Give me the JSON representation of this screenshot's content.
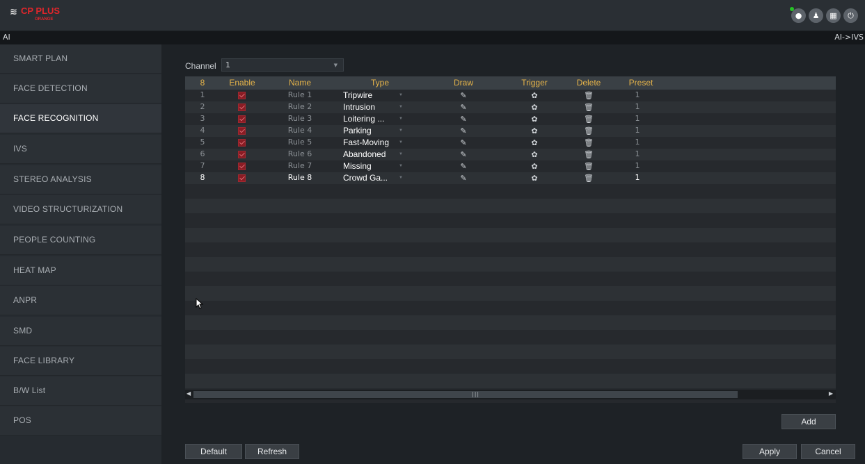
{
  "app": {
    "logo_mark": "≋",
    "logo_text": "CP PLUS",
    "logo_sub": "ORANGE"
  },
  "header_icons": [
    {
      "name": "camera-eye-icon",
      "glyph": "●"
    },
    {
      "name": "user-icon",
      "glyph": "♟"
    },
    {
      "name": "menu-grid-icon",
      "glyph": "▦"
    },
    {
      "name": "power-icon",
      "glyph": "⏻"
    }
  ],
  "breadcrumb": {
    "left": "AI",
    "right": "AI->IVS"
  },
  "sidebar": {
    "items": [
      {
        "label": "SMART PLAN"
      },
      {
        "label": "FACE DETECTION"
      },
      {
        "label": "FACE RECOGNITION"
      },
      {
        "label": "IVS"
      },
      {
        "label": "STEREO ANALYSIS"
      },
      {
        "label": "VIDEO STRUCTURIZATION"
      },
      {
        "label": "PEOPLE COUNTING"
      },
      {
        "label": "HEAT MAP"
      },
      {
        "label": "ANPR"
      },
      {
        "label": "SMD"
      },
      {
        "label": "FACE LIBRARY"
      },
      {
        "label": "B/W List"
      },
      {
        "label": "POS"
      }
    ],
    "active": "FACE RECOGNITION"
  },
  "channel": {
    "label": "Channel",
    "value": "1"
  },
  "table": {
    "headers": {
      "index": "8",
      "enable": "Enable",
      "name": "Name",
      "type": "Type",
      "draw": "Draw",
      "trigger": "Trigger",
      "delete": "Delete",
      "preset": "Preset"
    },
    "rows": [
      {
        "index": "1",
        "enabled": true,
        "name": "Rule 1",
        "type": "Tripwire",
        "preset": "1"
      },
      {
        "index": "2",
        "enabled": true,
        "name": "Rule 2",
        "type": "Intrusion",
        "preset": "1"
      },
      {
        "index": "3",
        "enabled": true,
        "name": "Rule 3",
        "type": "Loitering ...",
        "preset": "1"
      },
      {
        "index": "4",
        "enabled": true,
        "name": "Rule 4",
        "type": "Parking",
        "preset": "1"
      },
      {
        "index": "5",
        "enabled": true,
        "name": "Rule 5",
        "type": "Fast-Moving",
        "preset": "1"
      },
      {
        "index": "6",
        "enabled": true,
        "name": "Rule 6",
        "type": "Abandoned",
        "preset": "1"
      },
      {
        "index": "7",
        "enabled": true,
        "name": "Rule 7",
        "type": "Missing",
        "preset": "1"
      },
      {
        "index": "8",
        "enabled": true,
        "name": "Rule 8",
        "type": "Crowd Ga...",
        "preset": "1"
      }
    ],
    "selected_row": "8"
  },
  "buttons": {
    "add": "Add",
    "default": "Default",
    "refresh": "Refresh",
    "apply": "Apply",
    "cancel": "Cancel"
  },
  "icons": {
    "draw": "pencil-icon",
    "trigger": "gear-icon",
    "delete": "trash-icon"
  },
  "colors": {
    "accent_header_text": "#e6b44a",
    "brand_red": "#e0262b",
    "checkbox": "#8a1c24"
  }
}
